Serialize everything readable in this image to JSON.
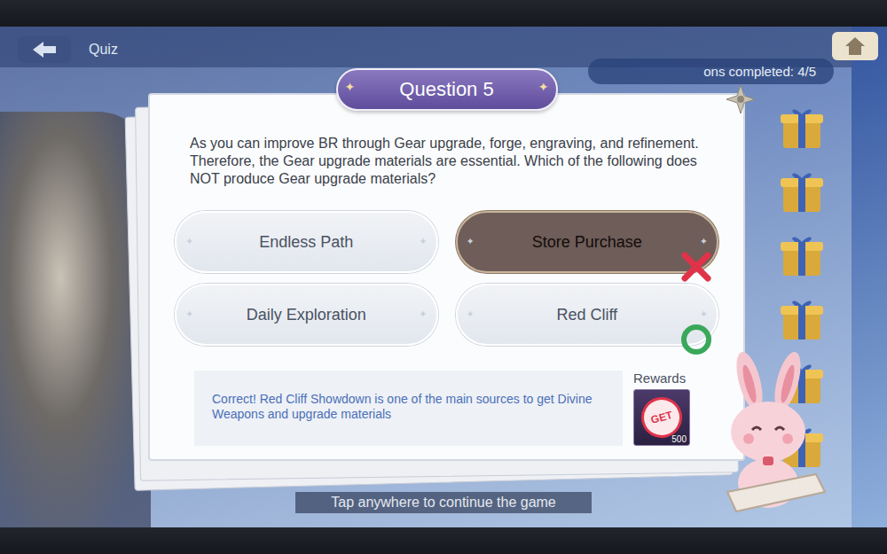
{
  "background": {
    "title": "Quiz",
    "progress": "ons completed: 4/5",
    "milestones": [
      {
        "claimed": false
      },
      {
        "claimed": false
      },
      {
        "claimed": false
      },
      {
        "claimed": false
      },
      {
        "claimed": false
      },
      {
        "claimed": false
      }
    ]
  },
  "dialog": {
    "title": "Question 5",
    "question": "As you can improve BR through Gear upgrade, forge, engraving, and refinement. Therefore, the Gear upgrade materials are essential. Which of the following does NOT produce Gear upgrade materials?",
    "options": [
      {
        "label": "Endless Path",
        "selected": false,
        "correct": false
      },
      {
        "label": "Store Purchase",
        "selected": true,
        "correct": false
      },
      {
        "label": "Daily Exploration",
        "selected": false,
        "correct": false
      },
      {
        "label": "Red Cliff",
        "selected": false,
        "correct": true
      }
    ],
    "feedback": "Correct! Red Cliff Showdown is one of the main sources to get Divine Weapons and upgrade materials",
    "rewards": {
      "label": "Rewards",
      "items": [
        {
          "badge": "GET",
          "count": "500"
        }
      ]
    }
  },
  "hint": "Tap anywhere to continue the game"
}
